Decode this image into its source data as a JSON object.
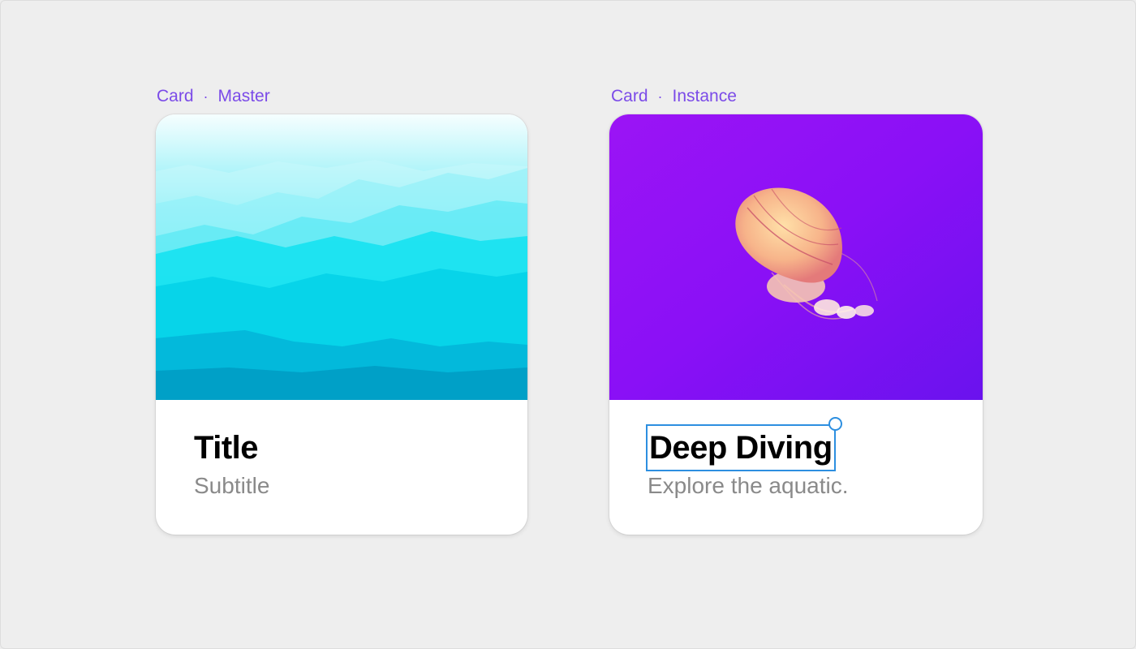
{
  "master": {
    "label_component": "Card",
    "label_separator": "·",
    "label_kind": "Master",
    "title": "Title",
    "subtitle": "Subtitle",
    "image": "mountains-image"
  },
  "instance": {
    "label_component": "Card",
    "label_separator": "·",
    "label_kind": "Instance",
    "title": "Deep Diving",
    "subtitle": "Explore the aquatic.",
    "image": "jellyfish-image"
  },
  "colors": {
    "canvas_bg": "#eeeeee",
    "label": "#7b4be8",
    "selection": "#2d8fe0",
    "subtitle": "#8a8a8a"
  }
}
